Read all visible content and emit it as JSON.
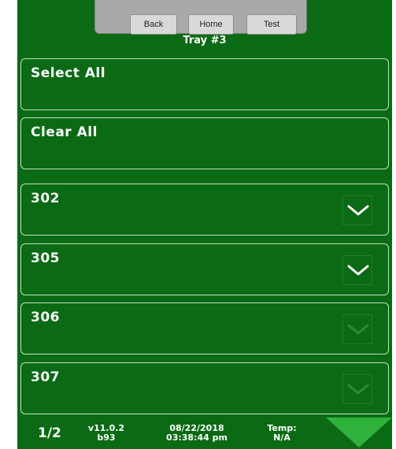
{
  "nav": {
    "back_label": "Back",
    "home_label": "Home",
    "test_label": "Test"
  },
  "title": "Tray #3",
  "actions": {
    "select_all": "Select All",
    "clear_all": "Clear All"
  },
  "items": [
    {
      "label": "302",
      "checked": true
    },
    {
      "label": "305",
      "checked": true
    },
    {
      "label": "306",
      "checked": false
    },
    {
      "label": "307",
      "checked": false
    }
  ],
  "footer": {
    "page": "1/2",
    "version": "v11.0.2",
    "build": "b93",
    "date": "08/22/2018",
    "time": "03:38:44 pm",
    "temp_label": "Temp:",
    "temp_value": "N/A"
  },
  "colors": {
    "background": "#0a6b14",
    "check_on": "#ffffff",
    "check_off": "#2d8a35",
    "arrow": "#2fb23c"
  }
}
